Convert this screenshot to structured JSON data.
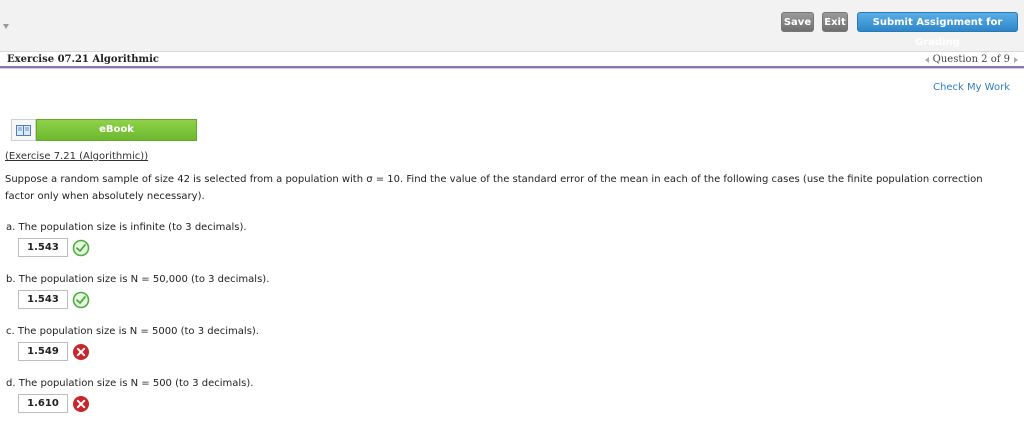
{
  "toolbar": {
    "save_label": "Save",
    "exit_label": "Exit",
    "submit_label": "Submit Assignment for Grading"
  },
  "header": {
    "exercise_title": "Exercise 07.21 Algorithmic",
    "question_nav": "Question 2 of 9"
  },
  "check_my_work": "Check My Work",
  "ebook": {
    "label": "eBook",
    "icon": "book-icon"
  },
  "exercise_link": "(Exercise 7.21 (Algorithmic))",
  "question_text": "Suppose a random sample of size 42 is selected from a population with σ = 10. Find the value of the standard error of the mean in each of the following cases (use the finite population correction factor only when absolutely necessary).",
  "parts": [
    {
      "label": "a. The population size is infinite (to 3 decimals).",
      "answer": "1.543",
      "status": "correct"
    },
    {
      "label": "b. The population size is N = 50,000 (to 3 decimals).",
      "answer": "1.543",
      "status": "correct"
    },
    {
      "label": "c. The population size is N = 5000 (to 3 decimals).",
      "answer": "1.549",
      "status": "incorrect"
    },
    {
      "label": "d. The population size is N = 500 (to 3 decimals).",
      "answer": "1.610",
      "status": "incorrect"
    }
  ],
  "colors": {
    "correct": "#4caf3a",
    "incorrect": "#c8262a",
    "link": "#2f7dc4",
    "accent_purple": "#8a78a8"
  }
}
